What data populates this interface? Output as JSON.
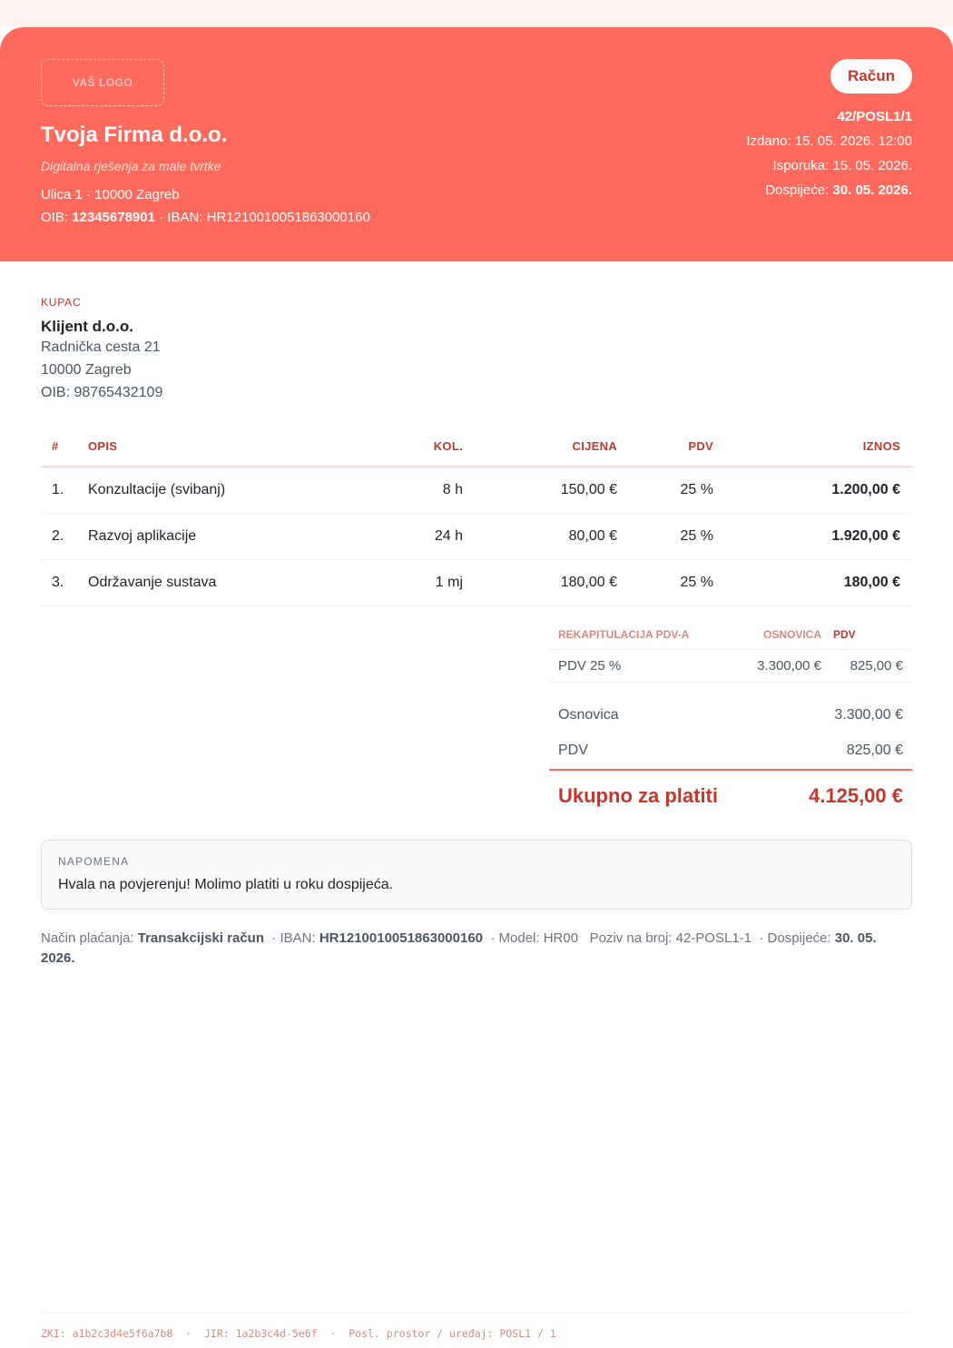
{
  "colors": {
    "accent": "#ff6a5c",
    "accent_dark": "#c0392b"
  },
  "logo_placeholder": "VAŠ LOGO",
  "seller": {
    "name": "Tvoja Firma d.o.o.",
    "tagline": "Digitalna rješenja za male tvrtke",
    "address": "Ulica 1 · 10000 Zagreb",
    "oib_label": "OIB:",
    "oib": "12345678901",
    "iban_text": "· IBAN: HR1210010051863000160"
  },
  "document": {
    "type": "Račun",
    "number": "42/POSL1/1",
    "issued": "Izdano: 15. 05. 2026. 12:00",
    "delivery": "Isporuka: 15. 05. 2026.",
    "due_label": "Dospijeće:",
    "due_value": "30. 05. 2026."
  },
  "buyer": {
    "label": "KUPAC",
    "name": "Klijent d.o.o.",
    "street": "Radnička cesta 21",
    "city": "10000 Zagreb",
    "oib": "OIB: 98765432109"
  },
  "items_header": {
    "num": "#",
    "desc": "OPIS",
    "qty": "KOL.",
    "price": "CIJENA",
    "vat": "PDV",
    "amount": "IZNOS"
  },
  "items": [
    {
      "num": "1.",
      "desc": "Konzultacije (svibanj)",
      "qty": "8 h",
      "price": "150,00 €",
      "vat": "25 %",
      "amount": "1.200,00 €"
    },
    {
      "num": "2.",
      "desc": "Razvoj aplikacije",
      "qty": "24 h",
      "price": "80,00 €",
      "vat": "25 %",
      "amount": "1.920,00 €"
    },
    {
      "num": "3.",
      "desc": "Održavanje sustava",
      "qty": "1 mj",
      "price": "180,00 €",
      "vat": "25 %",
      "amount": "180,00 €"
    }
  ],
  "recap": {
    "h_label": "REKAPITULACIJA PDV-A",
    "h_base": "OSNOVICA",
    "h_vat": "PDV",
    "row_label": "PDV 25 %",
    "row_base": "3.300,00 €",
    "row_vat": "825,00 €"
  },
  "totals": {
    "base_label": "Osnovica",
    "base_value": "3.300,00 €",
    "vat_label": "PDV",
    "vat_value": "825,00 €",
    "total_label": "Ukupno za platiti",
    "total_value": "4.125,00 €"
  },
  "note": {
    "label": "NAPOMENA",
    "text": "Hvala na povjerenju! Molimo platiti u roku dospijeća."
  },
  "payment": {
    "method_label": "Način plaćanja:",
    "method": "Transakcijski račun",
    "iban_label": "· IBAN:",
    "iban": "HR1210010051863000160",
    "model": "· Model: HR00",
    "reference": "Poziv na broj: 42-POSL1-1",
    "due_label": "· Dospijeće:",
    "due": "30. 05. 2026."
  },
  "footer": "ZKI: a1b2c3d4e5f6a7b8  ·  JIR: 1a2b3c4d-5e6f  ·  Posl. prostor / uređaj: POSL1 / 1"
}
